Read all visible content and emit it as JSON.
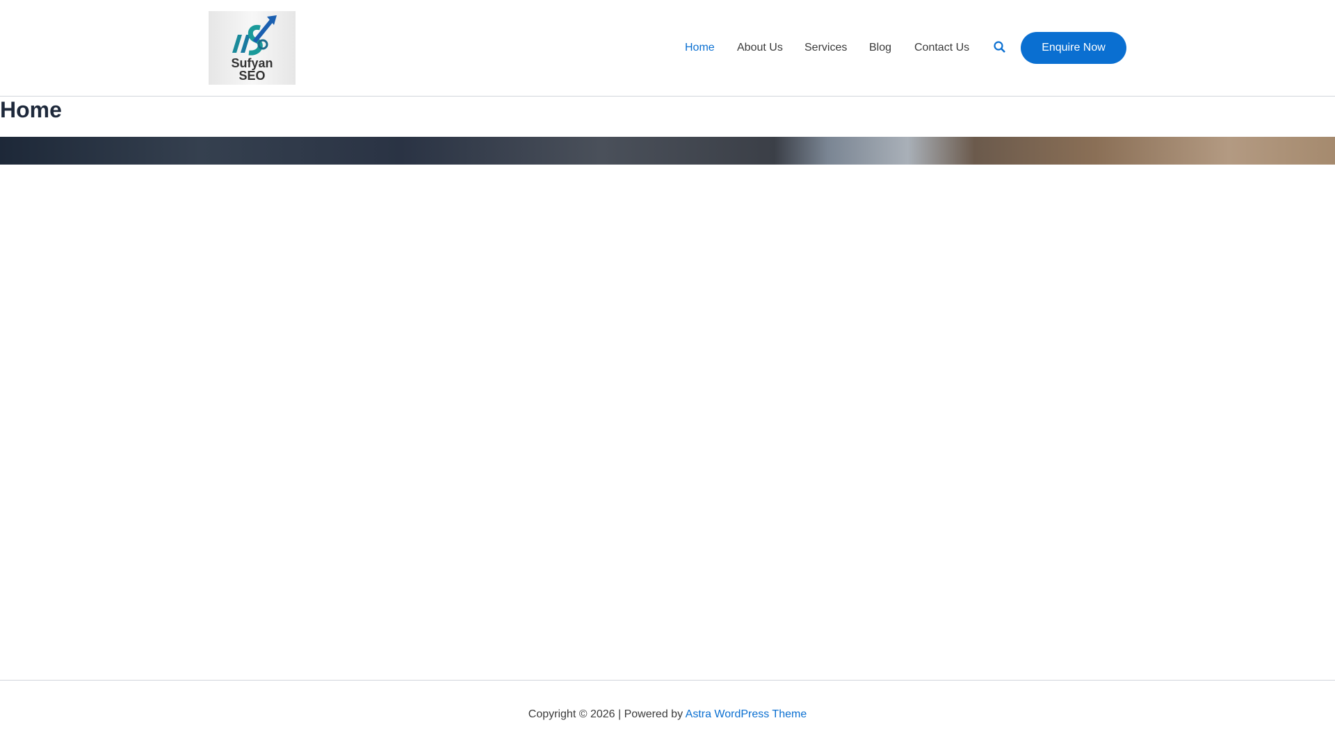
{
  "header": {
    "logo_line1": "Sufyan",
    "logo_line2": "SEO",
    "nav": [
      {
        "label": "Home"
      },
      {
        "label": "About Us"
      },
      {
        "label": "Services"
      },
      {
        "label": "Blog"
      },
      {
        "label": "Contact Us"
      }
    ],
    "search_icon": "search-icon",
    "cta": "Enquire Now"
  },
  "page": {
    "title": "Home"
  },
  "footer": {
    "copyright": "Copyright © 2026 | Powered by ",
    "link": "Astra WordPress Theme"
  },
  "colors": {
    "accent": "#0a6fd1"
  }
}
